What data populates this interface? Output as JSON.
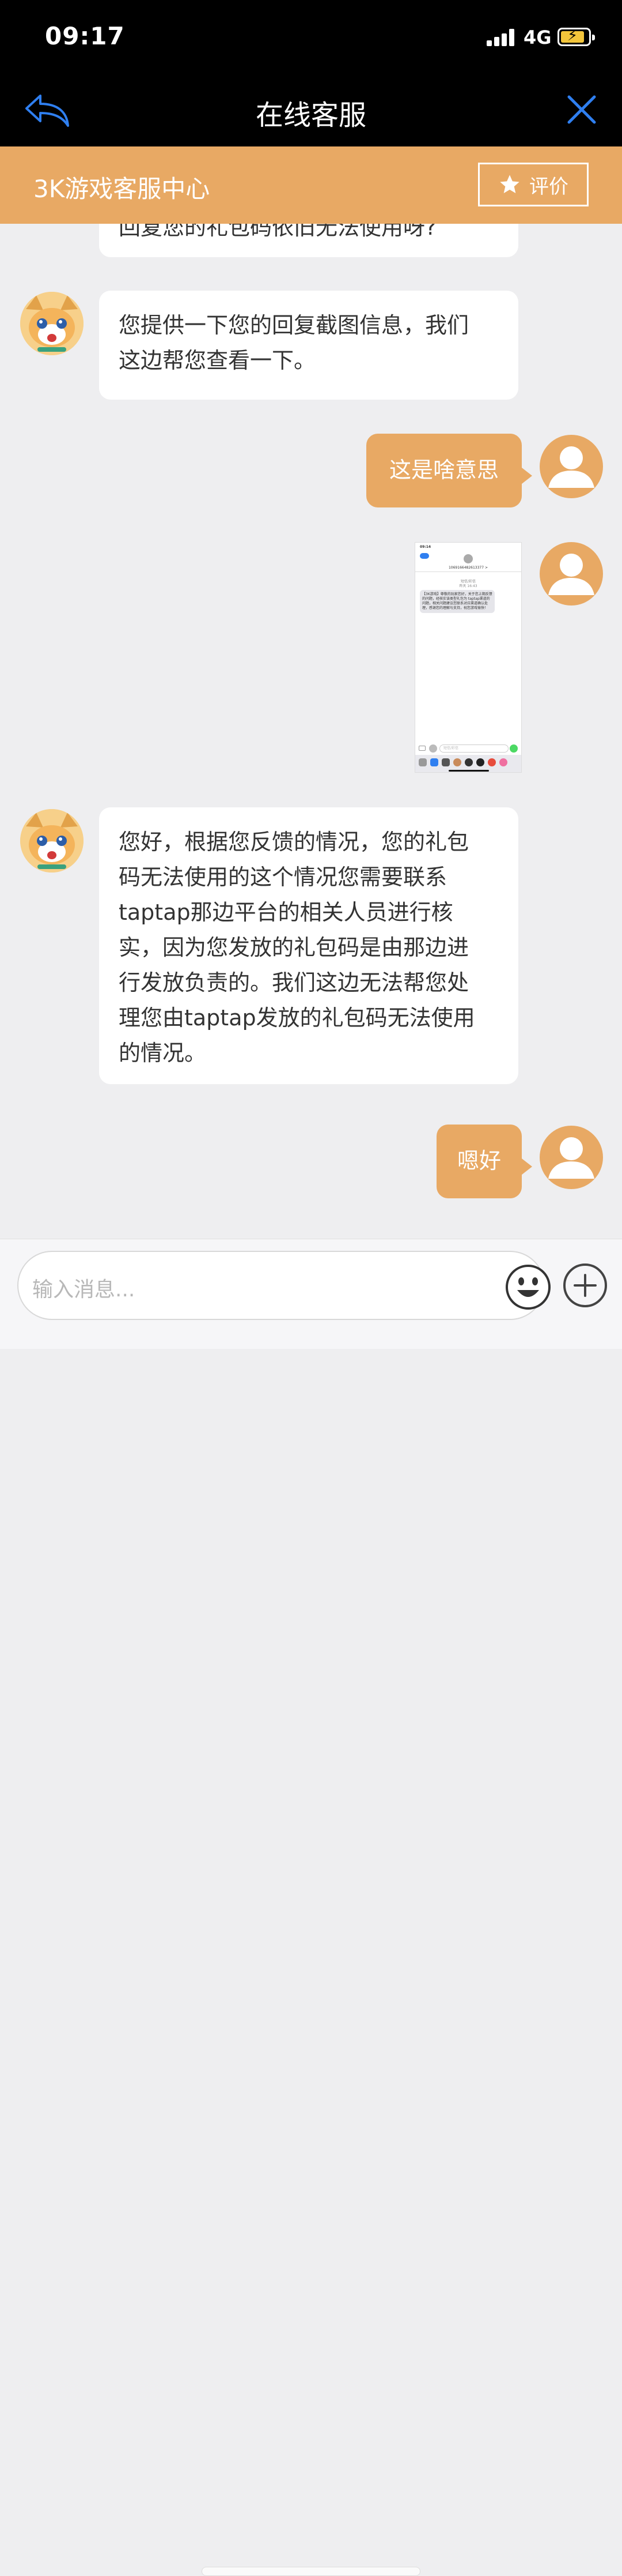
{
  "status_bar": {
    "time": "09:17",
    "network": "4G"
  },
  "nav": {
    "title": "在线客服",
    "back_icon": "back-arrow-icon",
    "close_icon": "close-icon"
  },
  "header": {
    "title": "3K游戏客服中心",
    "rate_label": "评价",
    "rate_icon": "star-icon"
  },
  "colors": {
    "accent": "#e8a964",
    "nav_bg": "#000000",
    "chat_bg": "#eeeef0",
    "close_icon": "#2f7ff0"
  },
  "messages": [
    {
      "side": "left",
      "text": "回复您的礼包码依旧无法使用呀?",
      "clipped": true
    },
    {
      "side": "left",
      "lines": [
        "您提供一下您的回复截图信息，我们",
        "这边帮您查看一下。"
      ]
    },
    {
      "side": "right",
      "text": "这是啥意思"
    },
    {
      "side": "right",
      "type": "image",
      "description": "screenshot"
    },
    {
      "side": "left",
      "lines": [
        "您好，根据您反馈的情况，您的礼包",
        "码无法使用的这个情况您需要联系",
        "taptap那边平台的相关人员进行核",
        "实，因为您发放的礼包码是由那边进",
        "行发放负责的。我们这边无法帮您处",
        "理您由taptap发放的礼包码无法使用",
        "的情况。"
      ]
    },
    {
      "side": "right",
      "text": "嗯好"
    }
  ],
  "thumbnail": {
    "time": "09:14",
    "sender": "1069166482613377 >",
    "meta": [
      "短信/彩信",
      "昨天 16:43"
    ],
    "sms": "【3K游戏】尊敬的玩家您好，关于您上期反馈的问题，经核实该类型礼包为 taptap渠道的问题，相关问题建议您联系对应渠道确认处理，感谢您的理解与支持，祝您游戏愉快！",
    "input_placeholder": "短信/彩信"
  },
  "input": {
    "placeholder": "输入消息..."
  }
}
